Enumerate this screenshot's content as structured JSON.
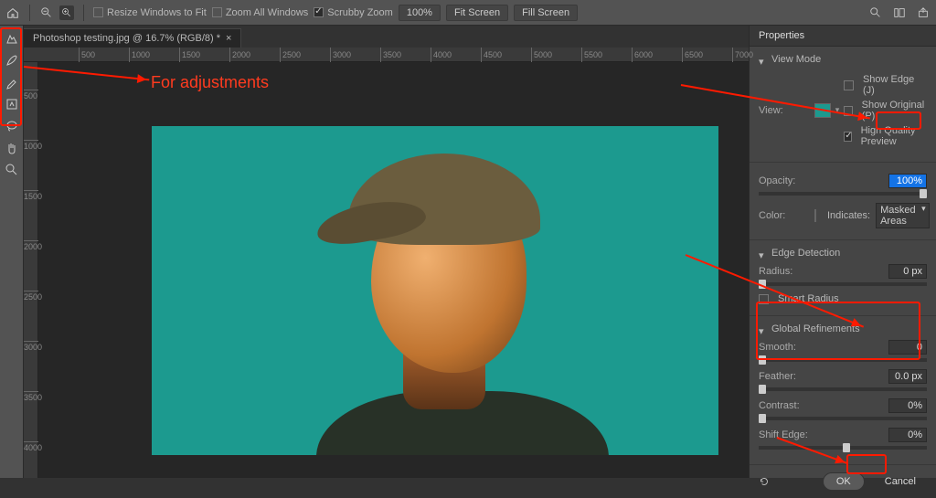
{
  "topbar": {
    "resize_label": "Resize Windows to Fit",
    "zoom_all_label": "Zoom All Windows",
    "scrubby_label": "Scrubby Zoom",
    "pct": "100%",
    "fit_screen": "Fit Screen",
    "fill_screen": "Fill Screen"
  },
  "tab": {
    "title": "Photoshop testing.jpg @ 16.7% (RGB/8) *"
  },
  "ruler_h": [
    "500",
    "1000",
    "1500",
    "2000",
    "2500",
    "3000",
    "3500",
    "4000",
    "4500",
    "5000",
    "5500",
    "6000",
    "6500",
    "7000"
  ],
  "ruler_v": [
    "500",
    "1000",
    "1500",
    "2000",
    "2500",
    "3000",
    "3500",
    "4000"
  ],
  "annotation": "For adjustments",
  "panel": {
    "title": "Properties",
    "view_mode": {
      "title": "View Mode",
      "view_label": "View:",
      "show_edge": "Show Edge (J)",
      "show_original": "Show Original (P)",
      "hq_preview": "High Quality Preview"
    },
    "opacity": {
      "label": "Opacity:",
      "value": "100%"
    },
    "color": {
      "label": "Color:",
      "indicates_label": "Indicates:",
      "indicates_value": "Masked Areas"
    },
    "edge": {
      "title": "Edge Detection",
      "radius_label": "Radius:",
      "radius_value": "0 px",
      "smart_label": "Smart Radius"
    },
    "refine": {
      "title": "Global Refinements",
      "smooth_label": "Smooth:",
      "smooth_value": "0",
      "feather_label": "Feather:",
      "feather_value": "0.0 px",
      "contrast_label": "Contrast:",
      "contrast_value": "0%",
      "shift_label": "Shift Edge:",
      "shift_value": "0%"
    },
    "ok": "OK",
    "cancel": "Cancel"
  }
}
